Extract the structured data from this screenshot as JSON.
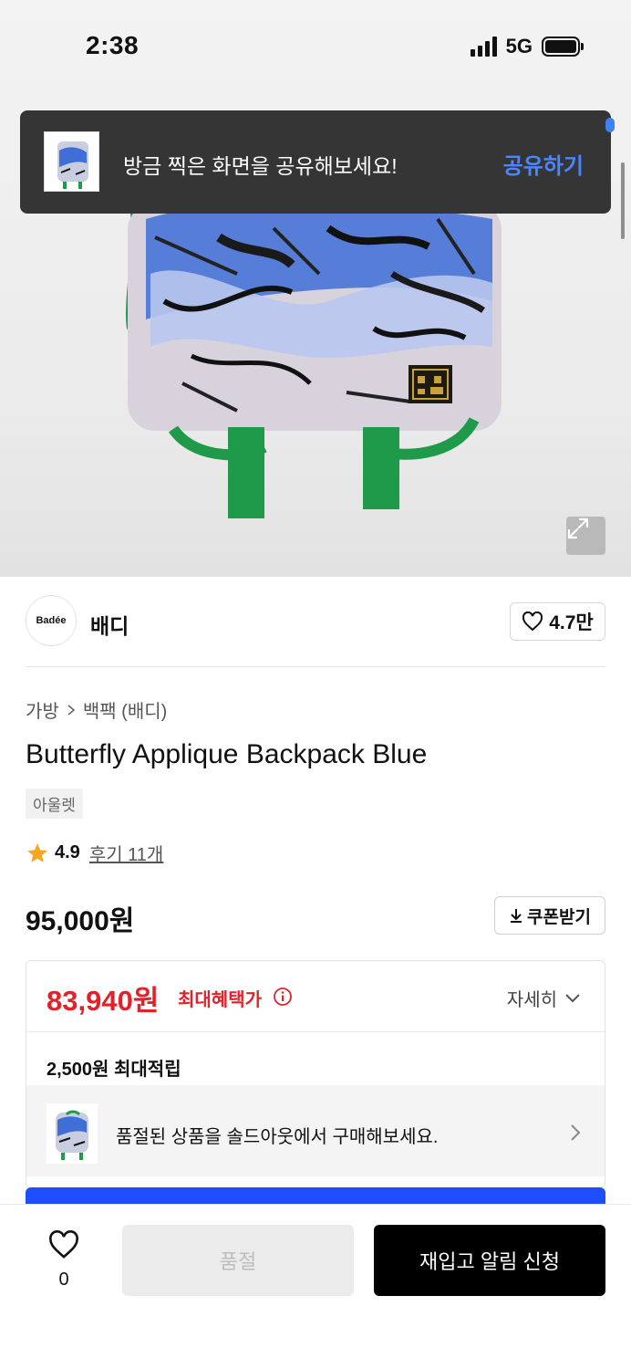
{
  "status_bar": {
    "time": "2:38",
    "network": "5G"
  },
  "toast": {
    "message": "방금 찍은 화면을 공유해보세요!",
    "action": "공유하기"
  },
  "brand": {
    "logo_text": "Badée",
    "name": "배디",
    "like_count": "4.7만"
  },
  "breadcrumb": {
    "category": "가방",
    "subcategory": "백팩 (배디)"
  },
  "product": {
    "title": "Butterfly Applique Backpack Blue",
    "badge": "아울렛",
    "rating": "4.9",
    "reviews": "후기 11개",
    "price": "95,000원",
    "coupon_label": "쿠폰받기"
  },
  "benefit": {
    "max_price": "83,940원",
    "max_label": "최대혜택가",
    "detail_label": "자세히",
    "points": "2,500원 최대적립",
    "soldout_message": "품절된 상품을 솔드아웃에서 구매해보세요."
  },
  "bottom_bar": {
    "wish_count": "0",
    "soldout_label": "품절",
    "restock_label": "재입고 알림 신청"
  },
  "colors": {
    "accent_red": "#e0232b",
    "action_blue": "#4a86ff",
    "primary_blue": "#1d4fff",
    "star": "#f5a623"
  },
  "icons": [
    "signal-icon",
    "battery-icon",
    "expand-icon",
    "heart-icon",
    "chevron-right-icon",
    "star-icon",
    "download-icon",
    "info-icon",
    "chevron-down-icon"
  ]
}
